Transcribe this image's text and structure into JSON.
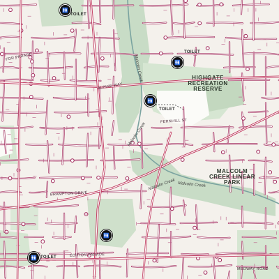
{
  "map": {
    "colors": {
      "background": "#f4f1ec",
      "road_casing": "#a0285a",
      "road_fill": "#ffffff",
      "main_road": "#c03a5f",
      "park": "#c8dcc6",
      "creek": "#7aa3a0",
      "toilet_icon": "#111111"
    },
    "parks": {
      "highgate": "HIGHGATE RECREATION RESERVE",
      "malcolm": "MALCOLM CREEK LINEAR PARK"
    },
    "toilet_label": "TOILET",
    "toilet_icon_glyph": "toilet-icon",
    "creek_labels": [
      "Malcolm Creek",
      "Malcolm Creek",
      "Malcolm Creek",
      "Malcolm Creek"
    ],
    "road_labels": [
      "ALPINE WAY",
      "FERNHILL ST",
      "BRAMPTON DRIVE",
      "MEDWAY ROAD",
      "FOR PARADE",
      "EDITION PARADE"
    ]
  }
}
